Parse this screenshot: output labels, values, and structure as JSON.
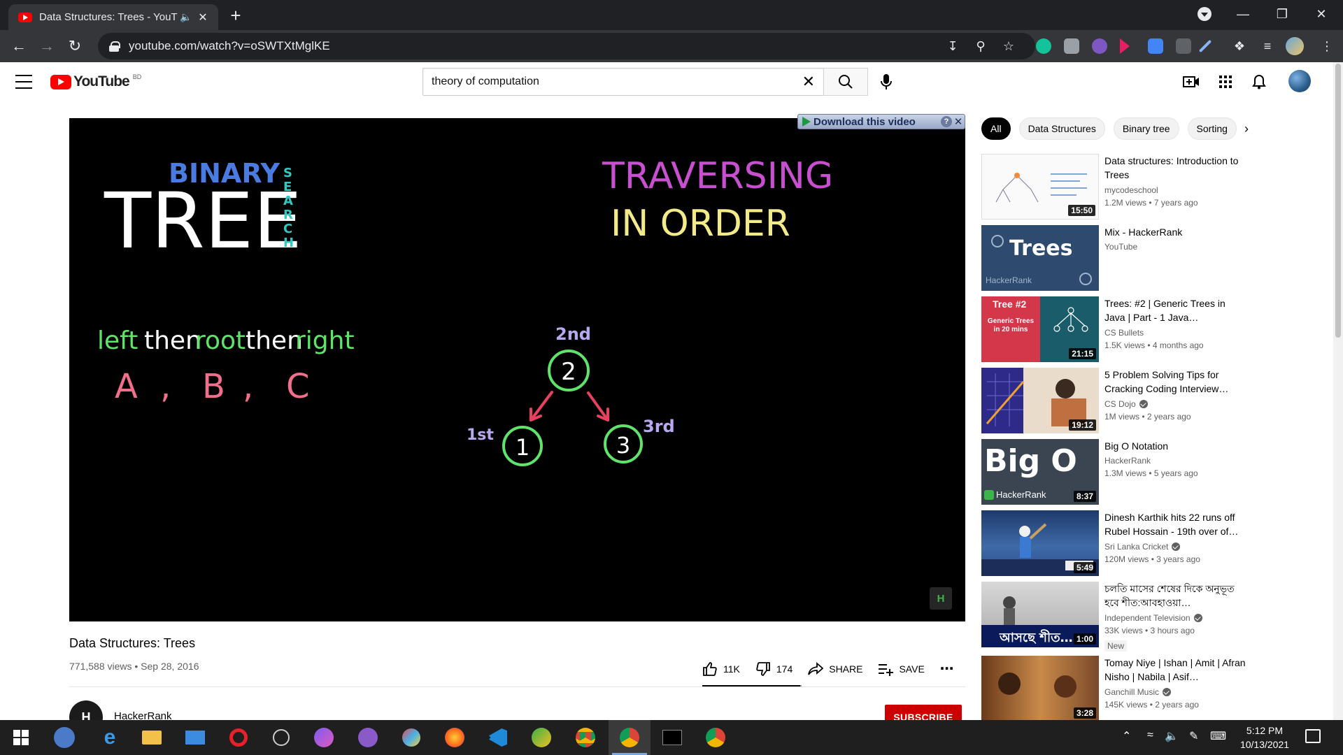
{
  "browser": {
    "tab_title": "Data Structures: Trees - YouTube",
    "tab_audio_icon": "speaker-icon",
    "url": "youtube.com/watch?v=oSWTXtMglKE"
  },
  "masthead": {
    "logo_text": "YouTube",
    "country_code": "BD",
    "search_value": "theory of computation"
  },
  "player": {
    "download_bar_label": "Download this video",
    "download_help": "?",
    "watermark": "H",
    "slide": {
      "tree_word": "TREE",
      "binary_word": "BINARY",
      "search_letters": [
        "S",
        "E",
        "A",
        "R",
        "C",
        "H"
      ],
      "heading_line1": "TRAVERSING",
      "heading_line2": "IN ORDER",
      "rule_words": [
        "left",
        "then",
        "root",
        "then",
        "right"
      ],
      "sequence": [
        "A",
        ",",
        "B",
        ",",
        "C"
      ],
      "root_node": "2",
      "left_node": "1",
      "right_node": "3",
      "root_order": "2nd",
      "left_order": "1st",
      "right_order": "3rd"
    }
  },
  "video": {
    "title": "Data Structures: Trees",
    "meta": "771,588 views • Sep 28, 2016",
    "likes": "11K",
    "dislikes": "174",
    "like_ratio": 0.984,
    "share_label": "SHARE",
    "save_label": "SAVE",
    "channel_name": "HackerRank",
    "channel_avatar_text": "H",
    "subscribe_label": "SUBSCRIBE"
  },
  "chips": [
    "All",
    "Data Structures",
    "Binary tree",
    "Sorting"
  ],
  "recommendations": [
    {
      "title": "Data structures: Introduction to Trees",
      "channel": "mycodeschool",
      "verified": false,
      "stats": "1.2M views • 7 years ago",
      "duration": "15:50",
      "thumb_text": "",
      "badge": ""
    },
    {
      "title": "Mix - HackerRank",
      "channel": "YouTube",
      "verified": false,
      "stats": "",
      "duration": "",
      "thumb_text": "Trees",
      "thumb_sub": "HackerRank",
      "badge": ""
    },
    {
      "title": "Trees: #2 | Generic Trees in Java | Part - 1 Java…",
      "channel": "CS Bullets",
      "verified": false,
      "stats": "1.5K views • 4 months ago",
      "duration": "21:15",
      "thumb_text": "Tree #2",
      "thumb_sub": "Generic Trees in 20 mins",
      "badge": ""
    },
    {
      "title": "5 Problem Solving Tips for Cracking Coding Interview…",
      "channel": "CS Dojo",
      "verified": true,
      "stats": "1M views • 2 years ago",
      "duration": "19:12",
      "thumb_text": "",
      "badge": ""
    },
    {
      "title": "Big O Notation",
      "channel": "HackerRank",
      "verified": false,
      "stats": "1.3M views • 5 years ago",
      "duration": "8:37",
      "thumb_text": "Big O",
      "thumb_sub": "HackerRank",
      "badge": ""
    },
    {
      "title": "Dinesh Karthik hits 22 runs off Rubel Hossain - 19th over of…",
      "channel": "Sri Lanka Cricket",
      "verified": true,
      "stats": "120M views • 3 years ago",
      "duration": "5:49",
      "thumb_text": "",
      "badge": ""
    },
    {
      "title": "চলতি মাসের শেষের দিকে অনুভূত হবে শীত:আবহাওয়া…",
      "channel": "Independent Television",
      "verified": true,
      "stats": "33K views • 3 hours ago",
      "duration": "1:00",
      "thumb_text": "আসছে শীত…",
      "badge": "New"
    },
    {
      "title": "Tomay Niye | Ishan | Amit | Afran Nisho | Nabila | Asif…",
      "channel": "Ganchill Music",
      "verified": true,
      "stats": "145K views • 2 years ago",
      "duration": "3:28",
      "thumb_text": "",
      "badge": ""
    }
  ],
  "taskbar": {
    "time": "5:12 PM",
    "date": "10/13/2021"
  },
  "colors": {
    "youtube_red": "#ff0000",
    "subscribe_red": "#cc0000",
    "chrome_dark": "#202124"
  }
}
